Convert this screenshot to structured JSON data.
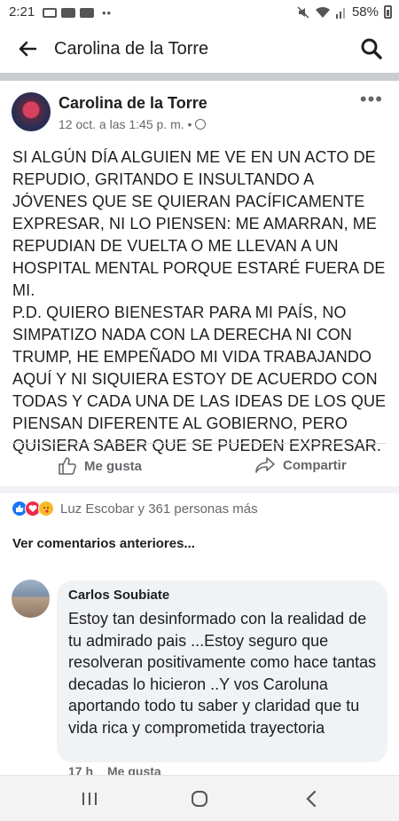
{
  "status_bar": {
    "time": "2:21",
    "battery": "58%"
  },
  "app_bar": {
    "title": "Carolina de la Torre"
  },
  "post": {
    "author": "Carolina de la Torre",
    "timestamp": "12 oct. a las 1:45 p. m. •",
    "body": "SI ALGÚN DÍA ALGUIEN ME VE EN UN ACTO DE REPUDIO, GRITANDO E INSULTANDO A JÓVENES QUE SE QUIERAN PACÍFICAMENTE EXPRESAR, NI LO PIENSEN: ME AMARRAN, ME REPUDIAN DE VUELTA O ME LLEVAN A UN HOSPITAL MENTAL PORQUE ESTARÉ FUERA DE MI.\nP.D. QUIERO BIENESTAR PARA MI PAÍS, NO SIMPATIZO NADA CON LA DERECHA NI CON TRUMP, HE EMPEÑADO MI VIDA TRABAJANDO AQUÍ Y NI SIQUIERA ESTOY DE ACUERDO CON TODAS Y CADA UNA DE LAS IDEAS DE LOS QUE PIENSAN DIFERENTE AL GOBIERNO,  PERO QUISIERA SABER QUE SE PUEDEN EXPRESAR."
  },
  "actions": {
    "like_label": "Me gusta",
    "share_label": "Compartir"
  },
  "reactions": {
    "summary": "Luz Escobar y 361 personas más"
  },
  "comments": {
    "view_previous": "Ver comentarios anteriores...",
    "items": [
      {
        "author": "Carlos Soubiate",
        "text": "Estoy tan desinformado con la realidad de tu admirado pais ...Estoy seguro que resolveran positivamente como hace tantas decadas lo hicieron ..Y vos Caroluna aportando todo tu saber y claridad que tu vida rica y comprometida trayectoria",
        "time": "17 h",
        "like_label": "Me gusta"
      }
    ]
  },
  "colors": {
    "accent": "#1877f2",
    "muted": "#65676b",
    "bubble": "#f0f2f5"
  }
}
